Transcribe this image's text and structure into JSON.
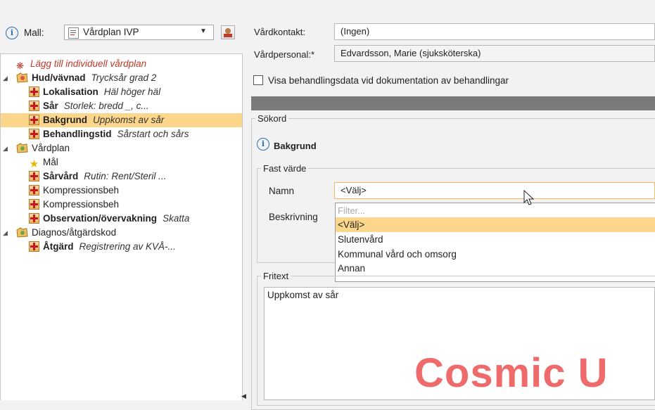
{
  "mall": {
    "label": "Mall:",
    "value": "Vårdplan IVP"
  },
  "tree": {
    "add_plan": "Lägg till individuell vårdplan",
    "items": [
      {
        "label": "Hud/vävnad",
        "detail": "Trycksår grad 2"
      },
      {
        "label": "Lokalisation",
        "detail": "Häl höger häl"
      },
      {
        "label": "Sår",
        "detail": "Storlek: bredd _, c..."
      },
      {
        "label": "Bakgrund",
        "detail": "Uppkomst av sår"
      },
      {
        "label": "Behandlingstid",
        "detail": "Sårstart och sårs"
      },
      {
        "label": "Vårdplan",
        "detail": ""
      },
      {
        "label": "Mål",
        "detail": ""
      },
      {
        "label": "Sårvård",
        "detail": "Rutin: Rent/Steril ..."
      },
      {
        "label": "Kompressionsbeh",
        "detail": ""
      },
      {
        "label": "Kompressionsbeh",
        "detail": ""
      },
      {
        "label": "Observation/övervakning",
        "detail": "Skatta"
      },
      {
        "label": "Diagnos/åtgärdskod",
        "detail": ""
      },
      {
        "label": "Åtgärd",
        "detail": "Registrering av KVÅ-..."
      }
    ]
  },
  "form": {
    "vardkontakt_label": "Vårdkontakt:",
    "vardkontakt_value": "(Ingen)",
    "vardpersonal_label": "Vårdpersonal:*",
    "vardpersonal_value": "Edvardsson, Marie (sjuksköterska)",
    "checkbox_label": "Visa behandlingsdata vid dokumentation av behandlingar",
    "sokord_legend": "Sökord",
    "section_title": "Bakgrund",
    "fast_varde_legend": "Fast värde",
    "namn_label": "Namn",
    "namn_value": "<Välj>",
    "beskrivning_label": "Beskrivning",
    "filter_placeholder": "Filter...",
    "options": [
      "<Välj>",
      "Slutenvård",
      "Kommunal vård och omsorg",
      "Annan"
    ],
    "fritext_legend": "Fritext",
    "fritext_value": "Uppkomst av sår"
  },
  "watermark": "Cosmic U"
}
